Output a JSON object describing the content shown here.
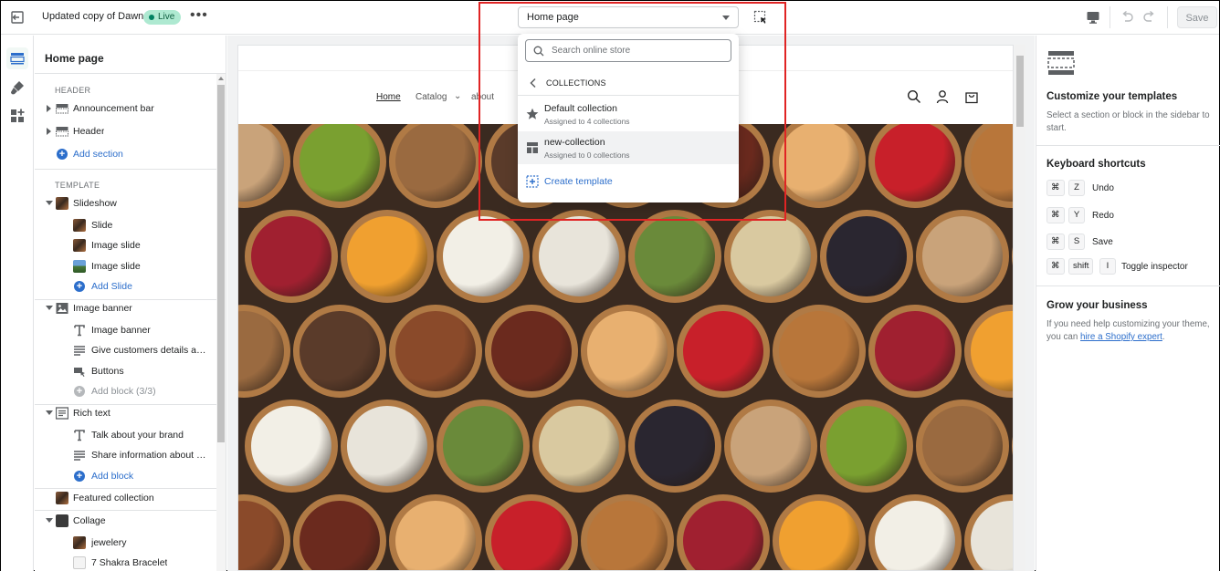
{
  "topbar": {
    "theme_name": "Updated copy of Dawn",
    "live_badge": "Live",
    "page_selector": "Home page",
    "save_label": "Save"
  },
  "sidebar": {
    "title": "Home page",
    "header_group": "HEADER",
    "header_items": [
      "Announcement bar",
      "Header"
    ],
    "add_section": "Add section",
    "template_group": "TEMPLATE",
    "slideshow": {
      "label": "Slideshow",
      "children": [
        "Slide",
        "Image slide",
        "Image slide"
      ],
      "add": "Add Slide"
    },
    "image_banner": {
      "label": "Image banner",
      "children": [
        "Image banner",
        "Give customers details abo...",
        "Buttons"
      ],
      "add": "Add block (3/3)"
    },
    "rich_text": {
      "label": "Rich text",
      "children": [
        "Talk about your brand",
        "Share information about yo..."
      ],
      "add": "Add block"
    },
    "featured_collection": "Featured collection",
    "collage": {
      "label": "Collage",
      "children": [
        "jewelery",
        "7 Shakra Bracelet"
      ]
    }
  },
  "preview": {
    "nav": [
      "Home",
      "Catalog",
      "about"
    ]
  },
  "dropdown": {
    "search_placeholder": "Search online store",
    "back_label": "COLLECTIONS",
    "items": [
      {
        "name": "Default collection",
        "sub": "Assigned to 4 collections"
      },
      {
        "name": "new-collection",
        "sub": "Assigned to 0 collections"
      }
    ],
    "create": "Create template"
  },
  "right_panel": {
    "title": "Customize your templates",
    "text": "Select a section or block in the sidebar to start.",
    "shortcuts_title": "Keyboard shortcuts",
    "shortcuts": [
      {
        "key": "Z",
        "label": "Undo"
      },
      {
        "key": "Y",
        "label": "Redo"
      },
      {
        "key": "S",
        "label": "Save"
      }
    ],
    "inspector_shortcut": {
      "key1": "shift",
      "key2": "I",
      "label": "Toggle inspector"
    },
    "grow_title": "Grow your business",
    "grow_text": "If you need help customizing your theme, you can ",
    "grow_link": "hire a Shopify expert",
    "grow_end": "."
  },
  "colors": {
    "accent": "#2c6ecb",
    "live": "#aee9d1",
    "highlight": "#e02424"
  }
}
